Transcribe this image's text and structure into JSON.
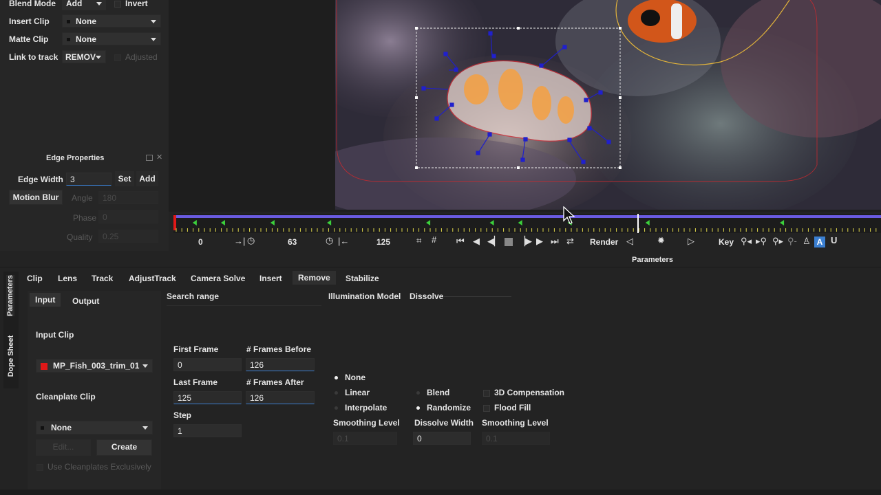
{
  "left_panel": {
    "blend_mode_label": "Blend Mode",
    "blend_mode_value": "Add",
    "invert_label": "Invert",
    "insert_clip_label": "Insert Clip",
    "insert_clip_value": "None",
    "matte_clip_label": "Matte Clip",
    "matte_clip_value": "None",
    "link_to_track_label": "Link to track",
    "link_to_track_value": "REMOV",
    "adjusted_label": "Adjusted"
  },
  "edge_properties": {
    "title": "Edge Properties",
    "edge_width_label": "Edge Width",
    "edge_width_value": "3",
    "set_label": "Set",
    "add_label": "Add",
    "motion_blur_label": "Motion Blur",
    "angle_label": "Angle",
    "angle_value": "180",
    "phase_label": "Phase",
    "phase_value": "0",
    "quality_label": "Quality",
    "quality_value": "0.25"
  },
  "timeline": {
    "start_frame": "0",
    "in_frame": "63",
    "end_frame": "125",
    "render_label": "Render",
    "key_label": "Key",
    "playhead_fraction": 0.656,
    "keyframes": [
      0.03,
      0.07,
      0.14,
      0.22,
      0.36,
      0.45,
      0.49,
      0.56,
      0.67,
      0.86
    ]
  },
  "parameters_header": "Parameters",
  "side_tabs": {
    "parameters": "Parameters",
    "dope_sheet": "Dope Sheet"
  },
  "tabs": [
    "Clip",
    "Lens",
    "Track",
    "AdjustTrack",
    "Camera Solve",
    "Insert",
    "Remove",
    "Stabilize"
  ],
  "active_tab": "Remove",
  "subtabs": {
    "input": "Input",
    "output": "Output"
  },
  "input_section": {
    "input_clip_label": "Input Clip",
    "input_clip_value": "MP_Fish_003_trim_01",
    "cleanplate_clip_label": "Cleanplate Clip",
    "cleanplate_clip_value": "None",
    "edit_label": "Edit...",
    "create_label": "Create",
    "use_cleanplates_label": "Use Cleanplates Exclusively"
  },
  "search_range": {
    "title": "Search range",
    "first_frame_label": "First Frame",
    "first_frame_value": "0",
    "frames_before_label": "# Frames Before",
    "frames_before_value": "126",
    "last_frame_label": "Last Frame",
    "last_frame_value": "125",
    "frames_after_label": "# Frames After",
    "frames_after_value": "126",
    "step_label": "Step",
    "step_value": "1"
  },
  "illumination": {
    "title": "Illumination Model",
    "none_label": "None",
    "linear_label": "Linear",
    "interpolate_label": "Interpolate",
    "smoothing_level_label": "Smoothing Level",
    "smoothing_level_value": "0.1"
  },
  "dissolve": {
    "title": "Dissolve",
    "blend_label": "Blend",
    "randomize_label": "Randomize",
    "dissolve_width_label": "Dissolve Width",
    "dissolve_width_value": "0"
  },
  "compensation": {
    "compensation_3d_label": "3D Compensation",
    "flood_fill_label": "Flood Fill",
    "smoothing_level_label": "Smoothing Level",
    "smoothing_level_value": "0.1"
  },
  "colors": {
    "accent_blue": "#3b7fd1",
    "timeline_bar": "#6a5be0",
    "keyframe_green": "#3cd13c",
    "tick_yellow": "#e0d84a",
    "spline_red": "#d8303a",
    "clip_red": "#e01818"
  }
}
